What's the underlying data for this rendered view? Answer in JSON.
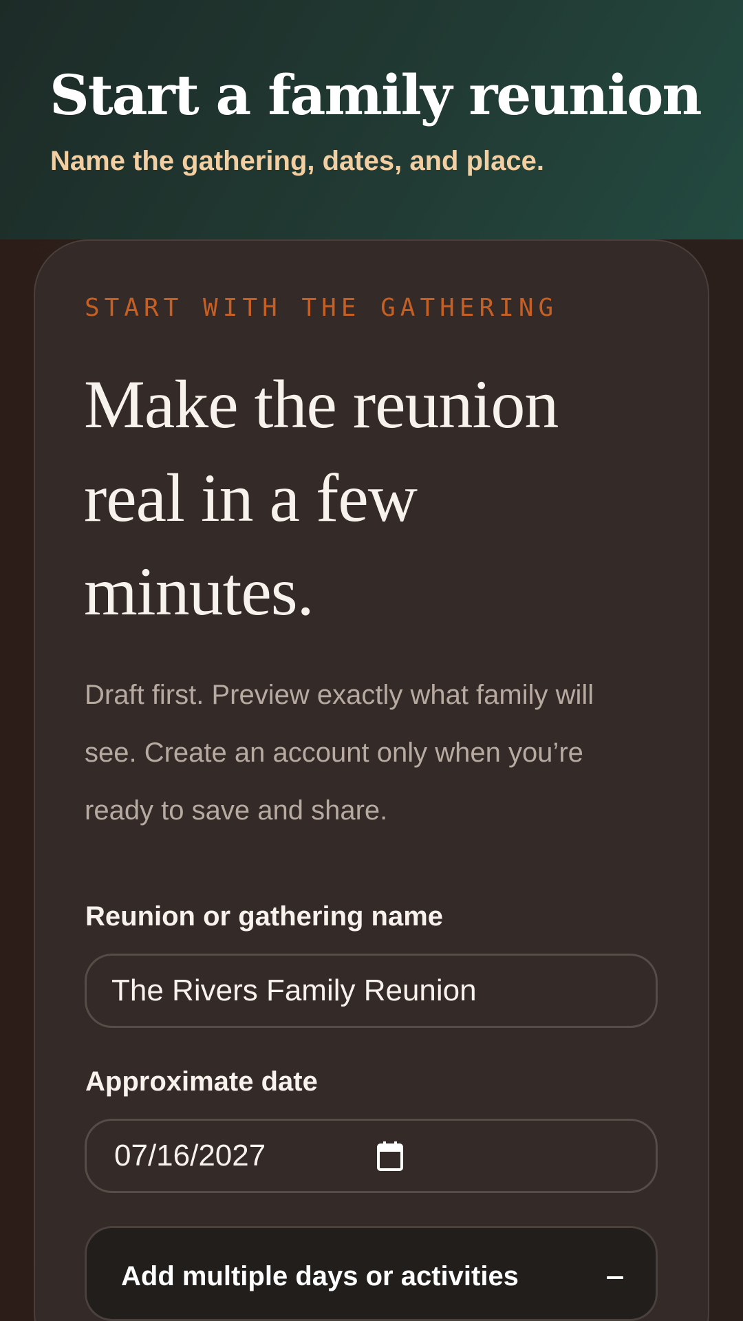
{
  "header": {
    "title": "Start a family reunion",
    "subtitle": "Name the gathering, dates, and place."
  },
  "card": {
    "eyebrow": "START WITH THE GATHERING",
    "hero": "Make the reunion real in a few minutes.",
    "lede": "Draft first. Preview exactly what family will see. Create an account only when you’re ready to save and share."
  },
  "form": {
    "name_label": "Reunion or gathering name",
    "name_value": "The Rivers Family Reunion",
    "date_label": "Approximate date",
    "date_value": "07/16/2027",
    "expander_label": "Add multiple days or activities",
    "expander_icon": "minus-icon"
  },
  "colors": {
    "header_bg": "#213a33",
    "accent": "#c65f24",
    "subtitle": "#f2cfa3",
    "card_bg": "#342a27",
    "page_bg": "#2b201b",
    "text": "#f7f2ec",
    "muted_text": "#b6aaa1"
  }
}
